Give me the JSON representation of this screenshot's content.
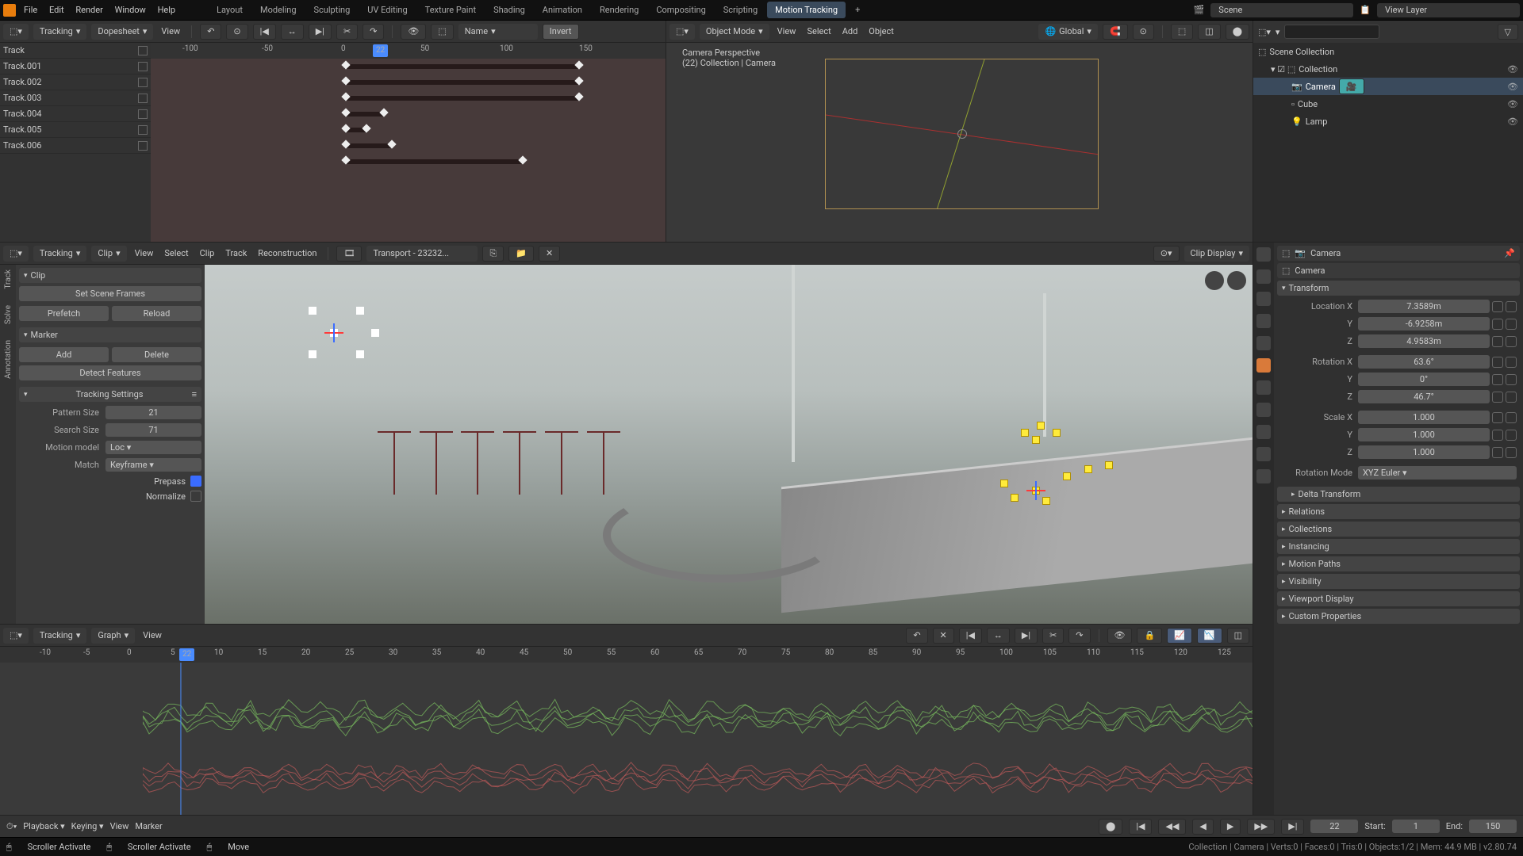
{
  "top": {
    "menus": [
      "File",
      "Edit",
      "Render",
      "Window",
      "Help"
    ],
    "tabs": [
      "Layout",
      "Modeling",
      "Sculpting",
      "UV Editing",
      "Texture Paint",
      "Shading",
      "Animation",
      "Rendering",
      "Compositing",
      "Scripting",
      "Motion Tracking"
    ],
    "active_tab": "Motion Tracking",
    "scene": "Scene",
    "view_layer": "View Layer"
  },
  "dopesheet": {
    "mode": "Tracking",
    "subtype": "Dopesheet",
    "view": "View",
    "name": "Name",
    "invert": "Invert",
    "tracks": [
      "Track",
      "Track.001",
      "Track.002",
      "Track.003",
      "Track.004",
      "Track.005",
      "Track.006"
    ],
    "ruler": [
      -100,
      -50,
      0,
      50,
      100,
      150
    ],
    "frame": 22
  },
  "view3d": {
    "mode": "Object Mode",
    "menus": [
      "View",
      "Select",
      "Add",
      "Object"
    ],
    "orient": "Global",
    "persp": "Camera Perspective",
    "info": "(22) Collection | Camera"
  },
  "outliner": {
    "root": "Scene Collection",
    "coll": "Collection",
    "items": [
      {
        "name": "Camera",
        "icon": "camera",
        "sel": true
      },
      {
        "name": "Cube",
        "icon": "mesh"
      },
      {
        "name": "Lamp",
        "icon": "light"
      }
    ]
  },
  "clip": {
    "mode": "Tracking",
    "subtype": "Clip",
    "menus": [
      "View",
      "Select",
      "Clip",
      "Track",
      "Reconstruction"
    ],
    "name": "Transport - 23232...",
    "display": "Clip Display",
    "side_tabs": [
      "Track",
      "Solve",
      "Annotation"
    ],
    "panels": {
      "clip": {
        "title": "Clip",
        "set_scene": "Set Scene Frames",
        "prefetch": "Prefetch",
        "reload": "Reload"
      },
      "marker": {
        "title": "Marker",
        "add": "Add",
        "delete": "Delete",
        "detect": "Detect Features"
      },
      "settings": {
        "title": "Tracking Settings",
        "pattern_lbl": "Pattern Size",
        "pattern": 21,
        "search_lbl": "Search Size",
        "search": 71,
        "motion_lbl": "Motion model",
        "motion": "Loc",
        "match_lbl": "Match",
        "match": "Keyframe",
        "prepass": "Prepass",
        "normalize": "Normalize"
      }
    }
  },
  "graph": {
    "mode": "Tracking",
    "subtype": "Graph",
    "view": "View",
    "frame": 22,
    "ticks": [
      -10,
      -5,
      0,
      5,
      10,
      15,
      20,
      25,
      30,
      35,
      40,
      45,
      50,
      55,
      60,
      65,
      70,
      75,
      80,
      85,
      90,
      95,
      100,
      105,
      110,
      115,
      120,
      125
    ]
  },
  "timeline": {
    "playback": "Playback",
    "keying": "Keying",
    "view": "View",
    "marker": "Marker",
    "frame": 22,
    "start_lbl": "Start:",
    "start": 1,
    "end_lbl": "End:",
    "end": 150
  },
  "props": {
    "item1": "Camera",
    "item2": "Camera",
    "transform": "Transform",
    "loc_lbl": "Location X",
    "loc": [
      "7.3589m",
      "-6.9258m",
      "4.9583m"
    ],
    "rot_lbl": "Rotation X",
    "rot": [
      "63.6°",
      "0°",
      "46.7°"
    ],
    "scale_lbl": "Scale X",
    "scale": [
      "1.000",
      "1.000",
      "1.000"
    ],
    "axes": [
      "Y",
      "Z"
    ],
    "rotmode_lbl": "Rotation Mode",
    "rotmode": "XYZ Euler",
    "sections": [
      "Delta Transform",
      "Relations",
      "Collections",
      "Instancing",
      "Motion Paths",
      "Visibility",
      "Viewport Display",
      "Custom Properties"
    ]
  },
  "status": {
    "left1": "Scroller Activate",
    "left2": "Scroller Activate",
    "left3": "Move",
    "right": "Collection | Camera | Verts:0 | Faces:0 | Tris:0 | Objects:1/2 | Mem: 44.9 MB | v2.80.74"
  }
}
